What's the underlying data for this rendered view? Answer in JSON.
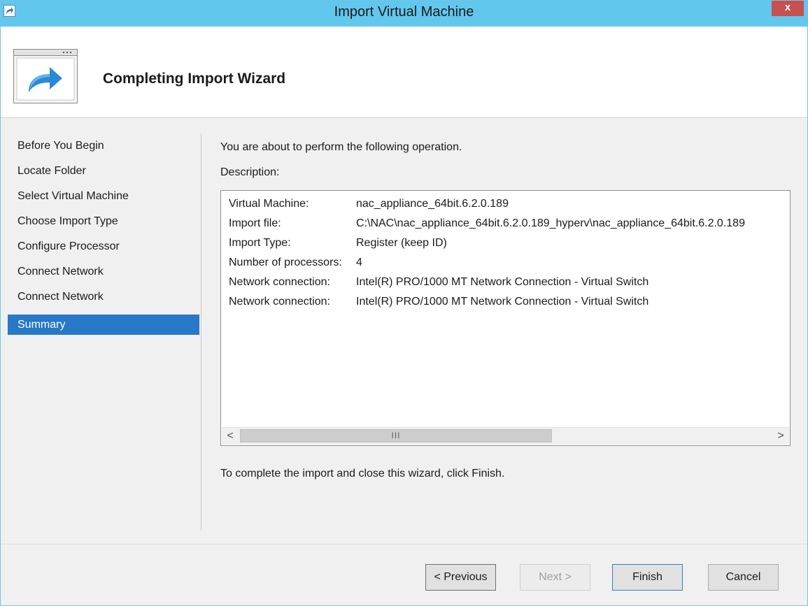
{
  "window": {
    "title": "Import Virtual Machine",
    "close_label": "x"
  },
  "header": {
    "title": "Completing Import Wizard"
  },
  "nav": {
    "items": [
      {
        "label": "Before You Begin",
        "active": false
      },
      {
        "label": "Locate Folder",
        "active": false
      },
      {
        "label": "Select Virtual Machine",
        "active": false
      },
      {
        "label": "Choose Import Type",
        "active": false
      },
      {
        "label": "Configure Processor",
        "active": false
      },
      {
        "label": "Connect Network",
        "active": false
      },
      {
        "label": "Connect Network",
        "active": false
      },
      {
        "label": "Summary",
        "active": true
      }
    ]
  },
  "content": {
    "intro": "You are about to perform the following operation.",
    "description_label": "Description:",
    "rows": [
      {
        "key": "Virtual Machine:",
        "value": "nac_appliance_64bit.6.2.0.189"
      },
      {
        "key": "Import file:",
        "value": "C:\\NAC\\nac_appliance_64bit.6.2.0.189_hyperv\\nac_appliance_64bit.6.2.0.189"
      },
      {
        "key": "Import Type:",
        "value": "Register (keep ID)"
      },
      {
        "key": "Number of processors:",
        "value": "4"
      },
      {
        "key": "Network connection:",
        "value": "Intel(R) PRO/1000 MT Network Connection - Virtual Switch"
      },
      {
        "key": "Network connection:",
        "value": "Intel(R) PRO/1000 MT Network Connection - Virtual Switch"
      }
    ],
    "scroll": {
      "left_arrow": "<",
      "right_arrow": ">",
      "grip": "III"
    },
    "footer": "To complete the import and close this wizard, click Finish."
  },
  "buttons": {
    "previous": "< Previous",
    "next": "Next >",
    "finish": "Finish",
    "cancel": "Cancel"
  },
  "colors": {
    "titlebar": "#62c7ec",
    "selection": "#2778c6",
    "close": "#c75050"
  }
}
